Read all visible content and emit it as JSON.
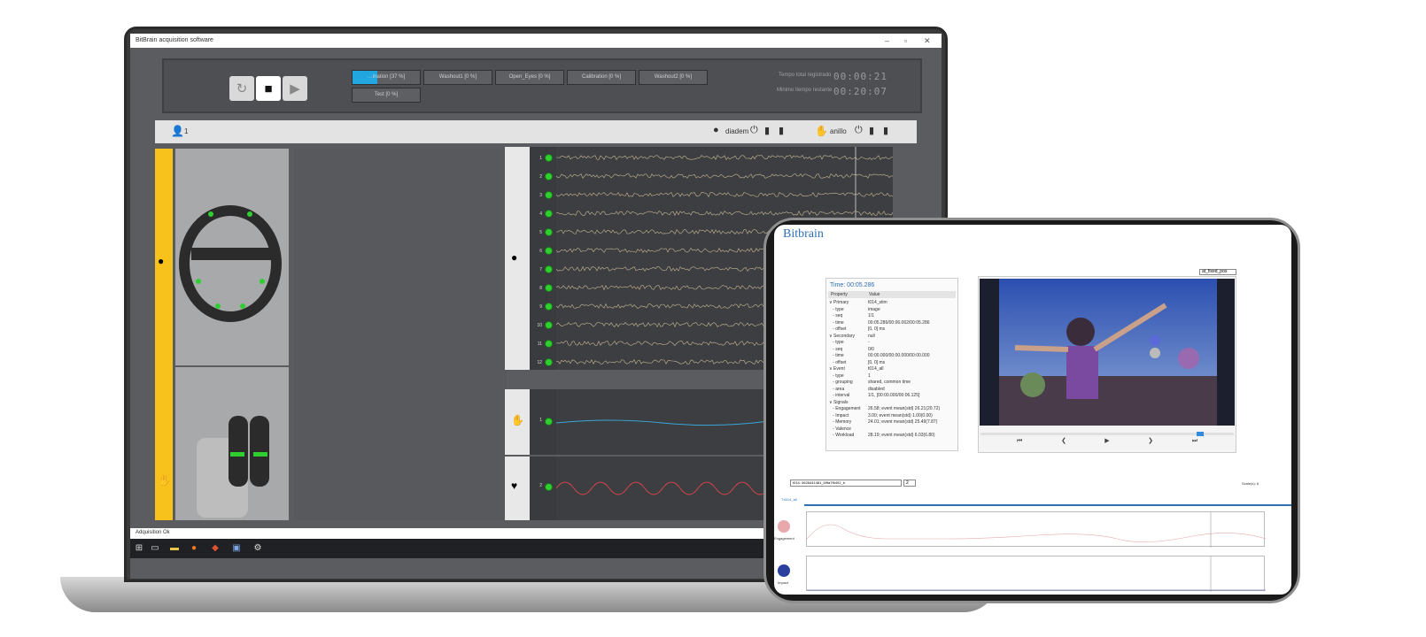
{
  "laptop": {
    "window_title": "BitBrain acquisition software",
    "controls": [
      {
        "icon": "refresh-icon",
        "glyph": "↻"
      },
      {
        "icon": "stop-icon",
        "glyph": "■"
      },
      {
        "icon": "play-icon",
        "glyph": "▶"
      }
    ],
    "phases": [
      {
        "label": "…ination [37 %]",
        "progress": 0.37,
        "active": true
      },
      {
        "label": "Washout1 [0 %]",
        "progress": 0
      },
      {
        "label": "Open_Eyes [0 %]",
        "progress": 0
      },
      {
        "label": "Calibration [0 %]",
        "progress": 0
      },
      {
        "label": "Washout2 [0 %]",
        "progress": 0
      },
      {
        "label": "Test [0 %]",
        "progress": 0
      }
    ],
    "timers": {
      "total_label": "Tempo total registrado",
      "total_value": "00:00:21",
      "remaining_label": "Minimo tiempo restante",
      "remaining_value": "00:20:07"
    },
    "status": {
      "user_count": "1",
      "device1_name": "diadem",
      "device2_name": "anillo"
    },
    "eeg_channels": [
      "1",
      "2",
      "3",
      "4",
      "5",
      "6",
      "7",
      "8",
      "9",
      "10",
      "11",
      "12"
    ],
    "aux_channels": [
      "1",
      "2"
    ],
    "footer_status": "Adquisition Ok",
    "taskbar_icons": [
      "windows-icon",
      "task-view-icon",
      "file-explorer-icon",
      "firefox-icon",
      "app-icon",
      "window-icon",
      "settings-icon"
    ],
    "colors": {
      "accent": "#22a6e0",
      "ok": "#2ec02e",
      "strip": "#f6c21b"
    }
  },
  "tablet": {
    "brand": "Bitbrain",
    "time_label": "Time: 00:05.286",
    "prop_header": {
      "property": "Property",
      "value": "Value"
    },
    "props": [
      {
        "k": "∨ Primary",
        "v": "t014_stim"
      },
      {
        "k": "   - type",
        "v": "image"
      },
      {
        "k": "   - seq",
        "v": "1/1"
      },
      {
        "k": "   - time",
        "v": "00:05.286/00:06.062/00:05.286"
      },
      {
        "k": "   - offset",
        "v": "[0, 0] ms"
      },
      {
        "k": "∨ Secondary",
        "v": "null"
      },
      {
        "k": "   - type",
        "v": "-"
      },
      {
        "k": "   - seq",
        "v": "0/0"
      },
      {
        "k": "   - time",
        "v": "00:00.000/00:00.000/00:00.000"
      },
      {
        "k": "   - offset",
        "v": "[0, 0] ms"
      },
      {
        "k": "∨ Event",
        "v": "t014_all"
      },
      {
        "k": "   - type",
        "v": "1"
      },
      {
        "k": "   - grouping",
        "v": "shared, common time"
      },
      {
        "k": "   - area",
        "v": "disabled"
      },
      {
        "k": "   - interval",
        "v": "1/1, [00:00.000/00:06.125]"
      },
      {
        "k": "∨ Signals",
        "v": ""
      },
      {
        "k": "   - Engagement",
        "v": "26.58; event mean(std) 26.21(20.72)"
      },
      {
        "k": "   - Impact",
        "v": "3.00; event mean(std) 1.00(0.00)"
      },
      {
        "k": "   - Memory",
        "v": "24.01; event mean(std) 25.49(7.87)"
      },
      {
        "k": "   - Valence",
        "v": ""
      },
      {
        "k": "   - Workload",
        "v": "28.19; event mean(std) 6.03(6.80)"
      }
    ],
    "view_select": "at_fixed_pos",
    "video_buttons": [
      "⏮",
      "❮",
      "▶",
      "❯",
      "⏭"
    ],
    "timeline_select": "t014: 0628441481_69fa7f6491_b",
    "page_select": "2",
    "scale_label": "Scale(s): 6",
    "track_name": "T4014_all",
    "tracks": [
      {
        "name": "Engagement",
        "color": "#e8a9ad"
      },
      {
        "name": "Impact",
        "color": "#2b3f9e"
      }
    ]
  }
}
